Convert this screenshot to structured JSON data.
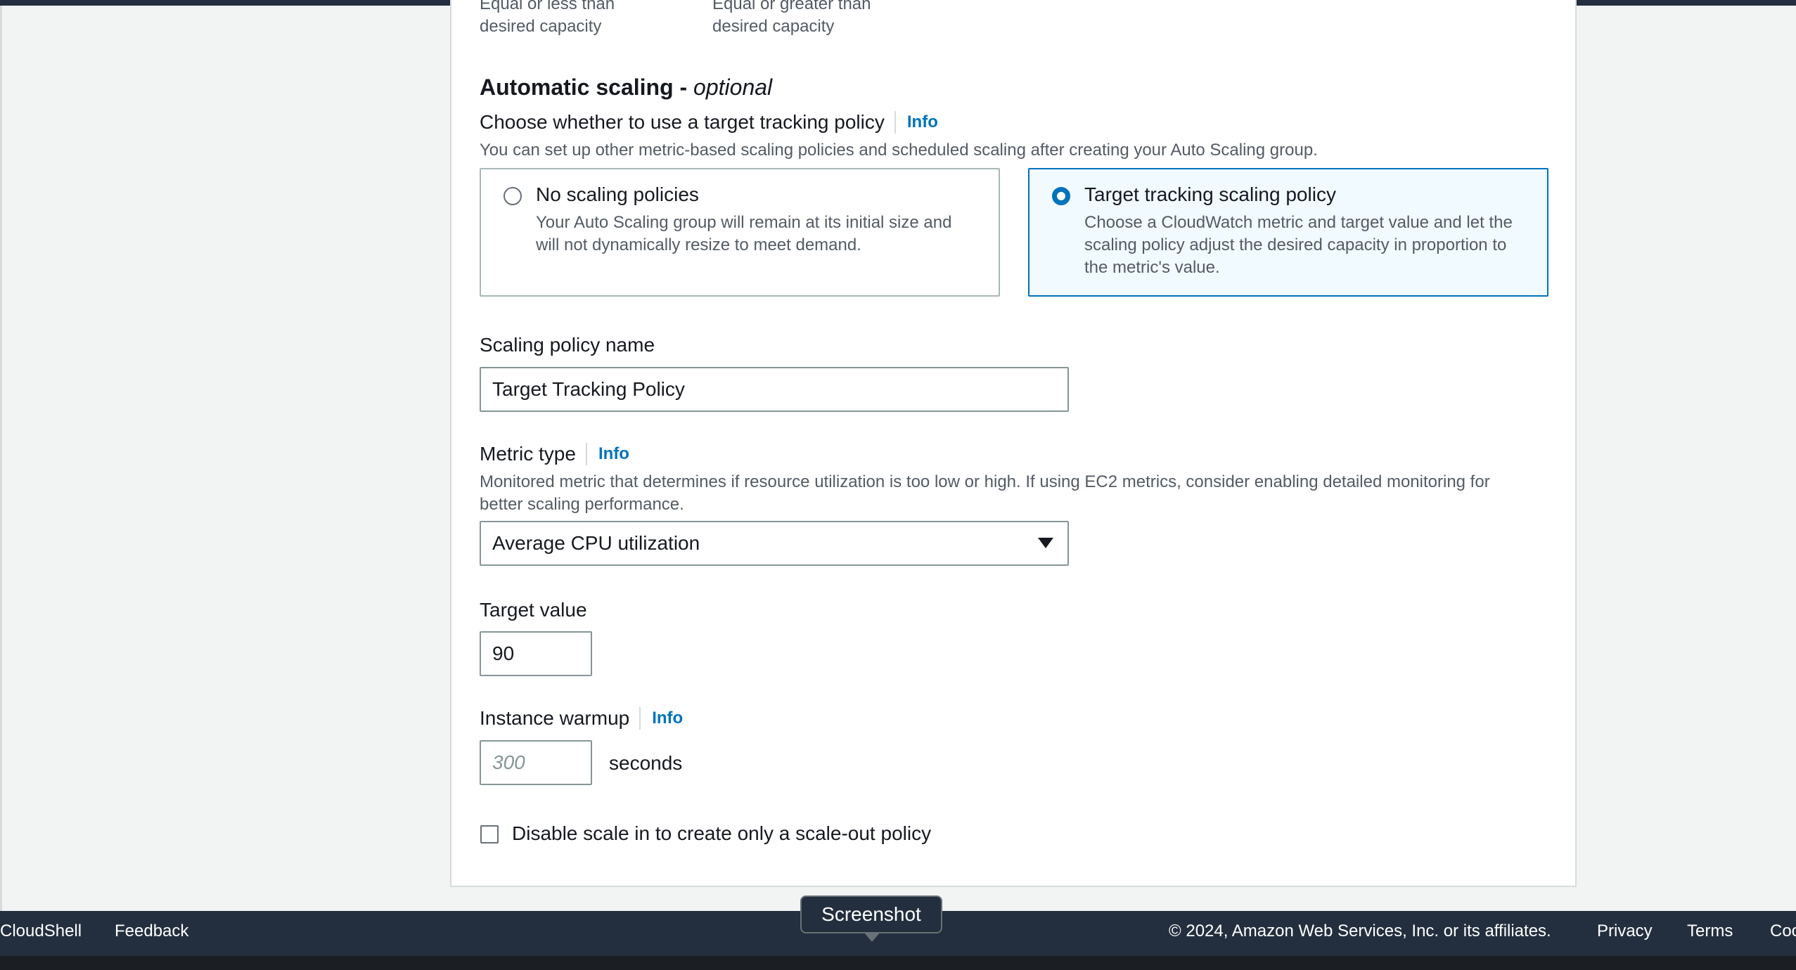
{
  "capacity_hints": {
    "min": {
      "line1": "Equal or less than",
      "line2": "desired capacity"
    },
    "max": {
      "line1": "Equal or greater than",
      "line2": "desired capacity"
    }
  },
  "automatic_scaling": {
    "title": "Automatic scaling - ",
    "title_suffix": "optional",
    "question": "Choose whether to use a target tracking policy",
    "info": "Info",
    "description": "You can set up other metric-based scaling policies and scheduled scaling after creating your Auto Scaling group.",
    "options": [
      {
        "title": "No scaling policies",
        "line1": "Your Auto Scaling group will remain at its initial size and",
        "line2": "will not dynamically resize to meet demand.",
        "selected": false
      },
      {
        "title": "Target tracking scaling policy",
        "line1": "Choose a CloudWatch metric and target value and let the",
        "line2": "scaling policy adjust the desired capacity in proportion to",
        "line3": "the metric's value.",
        "selected": true
      }
    ]
  },
  "policy_name": {
    "label": "Scaling policy name",
    "value": "Target Tracking Policy"
  },
  "metric_type": {
    "label": "Metric type",
    "info": "Info",
    "description_line1": "Monitored metric that determines if resource utilization is too low or high. If using EC2 metrics, consider enabling detailed monitoring for",
    "description_line2": "better scaling performance.",
    "selected": "Average CPU utilization"
  },
  "target_value": {
    "label": "Target value",
    "value": "90"
  },
  "instance_warmup": {
    "label": "Instance warmup",
    "info": "Info",
    "placeholder": "300",
    "unit": "seconds"
  },
  "disable_scale_in": {
    "label": "Disable scale in to create only a scale-out policy",
    "checked": false
  },
  "footer": {
    "cloudshell": "CloudShell",
    "feedback": "Feedback",
    "copyright": "© 2024, Amazon Web Services, Inc. or its affiliates.",
    "privacy": "Privacy",
    "terms": "Terms",
    "cookie": "Coo"
  },
  "tooltip": {
    "text": "Screenshot"
  },
  "colors": {
    "accent": "#0073bb",
    "footer_bg": "#232f3e",
    "selected_tile_bg": "#f1faff"
  }
}
